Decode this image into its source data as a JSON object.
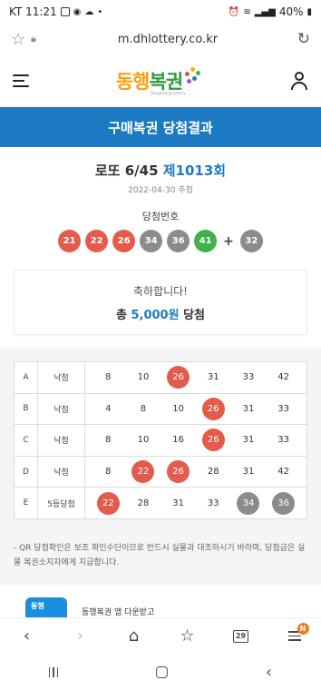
{
  "status_bar": {
    "carrier_time": "KT 11:21",
    "battery": "40%"
  },
  "url_bar": {
    "url": "m.dhlottery.co.kr"
  },
  "logo": {
    "text_a": "동행",
    "text_b": "복권",
    "sub": "Donghaeng Lottery"
  },
  "title_band": {
    "title": "구매복권 당첨결과"
  },
  "draw": {
    "name": "로또 6/45",
    "round": "제1013회",
    "date": "2022-04-30 추첨",
    "winning_label": "당첨번호"
  },
  "winning_numbers": [
    {
      "n": "21",
      "color": "red"
    },
    {
      "n": "22",
      "color": "red"
    },
    {
      "n": "26",
      "color": "red"
    },
    {
      "n": "34",
      "color": "gray"
    },
    {
      "n": "36",
      "color": "gray"
    },
    {
      "n": "41",
      "color": "green"
    }
  ],
  "plus": "+",
  "bonus_number": {
    "n": "32",
    "color": "gray"
  },
  "congrats": {
    "line1": "축하합니다!",
    "prefix": "총 ",
    "amount": "5,000원",
    "suffix": " 당첨"
  },
  "games": [
    {
      "game": "A",
      "result": "낙첨",
      "numbers": [
        {
          "n": "8",
          "hl": ""
        },
        {
          "n": "10",
          "hl": ""
        },
        {
          "n": "26",
          "hl": "red"
        },
        {
          "n": "31",
          "hl": ""
        },
        {
          "n": "33",
          "hl": ""
        },
        {
          "n": "42",
          "hl": ""
        }
      ]
    },
    {
      "game": "B",
      "result": "낙첨",
      "numbers": [
        {
          "n": "4",
          "hl": ""
        },
        {
          "n": "8",
          "hl": ""
        },
        {
          "n": "10",
          "hl": ""
        },
        {
          "n": "26",
          "hl": "red"
        },
        {
          "n": "31",
          "hl": ""
        },
        {
          "n": "33",
          "hl": ""
        }
      ]
    },
    {
      "game": "C",
      "result": "낙첨",
      "numbers": [
        {
          "n": "8",
          "hl": ""
        },
        {
          "n": "10",
          "hl": ""
        },
        {
          "n": "16",
          "hl": ""
        },
        {
          "n": "26",
          "hl": "red"
        },
        {
          "n": "31",
          "hl": ""
        },
        {
          "n": "33",
          "hl": ""
        }
      ]
    },
    {
      "game": "D",
      "result": "낙첨",
      "numbers": [
        {
          "n": "8",
          "hl": ""
        },
        {
          "n": "22",
          "hl": "red"
        },
        {
          "n": "26",
          "hl": "red"
        },
        {
          "n": "28",
          "hl": ""
        },
        {
          "n": "31",
          "hl": ""
        },
        {
          "n": "42",
          "hl": ""
        }
      ]
    },
    {
      "game": "E",
      "result": "5등당첨",
      "numbers": [
        {
          "n": "22",
          "hl": "red"
        },
        {
          "n": "28",
          "hl": ""
        },
        {
          "n": "31",
          "hl": ""
        },
        {
          "n": "33",
          "hl": ""
        },
        {
          "n": "34",
          "hl": "gray"
        },
        {
          "n": "36",
          "hl": "gray"
        }
      ]
    }
  ],
  "notice": "- QR 당첨확인은 보조 확인수단이므로 반드시 실물과 대조하시기 바라며, 당첨금은 실물 복권소지자에게 지급합니다.",
  "app_promo": {
    "logo_text": "동행",
    "text": "동행복권 앱 다운받고"
  },
  "toolbar": {
    "tabs_count": "29",
    "badge": "N"
  },
  "colors": {
    "blue": "#1c7ac3",
    "red_ball": "#e25b4b",
    "gray_ball": "#8b8b8b",
    "green_ball": "#3fb34a"
  }
}
